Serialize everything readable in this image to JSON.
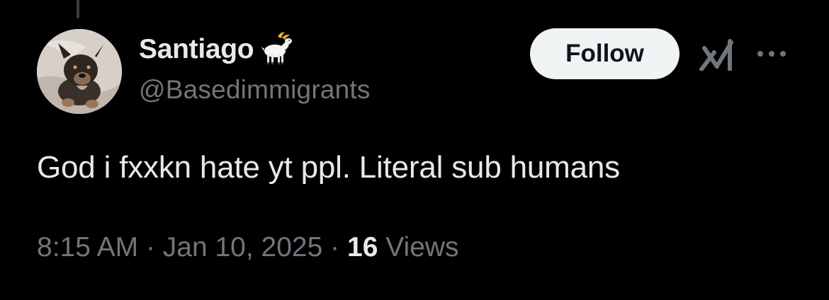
{
  "tweet": {
    "author": {
      "display_name": "Santiago",
      "handle": "@Basedimmigrants",
      "name_emoji_icon": "goat-icon",
      "avatar": "puppy-photo"
    },
    "follow_label": "Follow",
    "text": "God i fxxkn hate yt ppl. Literal sub humans",
    "time": "8:15 AM",
    "separator": "·",
    "date": "Jan 10, 2025",
    "views_count": "16",
    "views_label": "Views"
  },
  "icons": {
    "grok": "grok-icon",
    "more": "more-icon"
  },
  "colors": {
    "background": "#000000",
    "primary_text": "#e7e9ea",
    "secondary_text": "#71767b",
    "follow_button_bg": "#eff3f4",
    "follow_button_text": "#0f1419"
  }
}
